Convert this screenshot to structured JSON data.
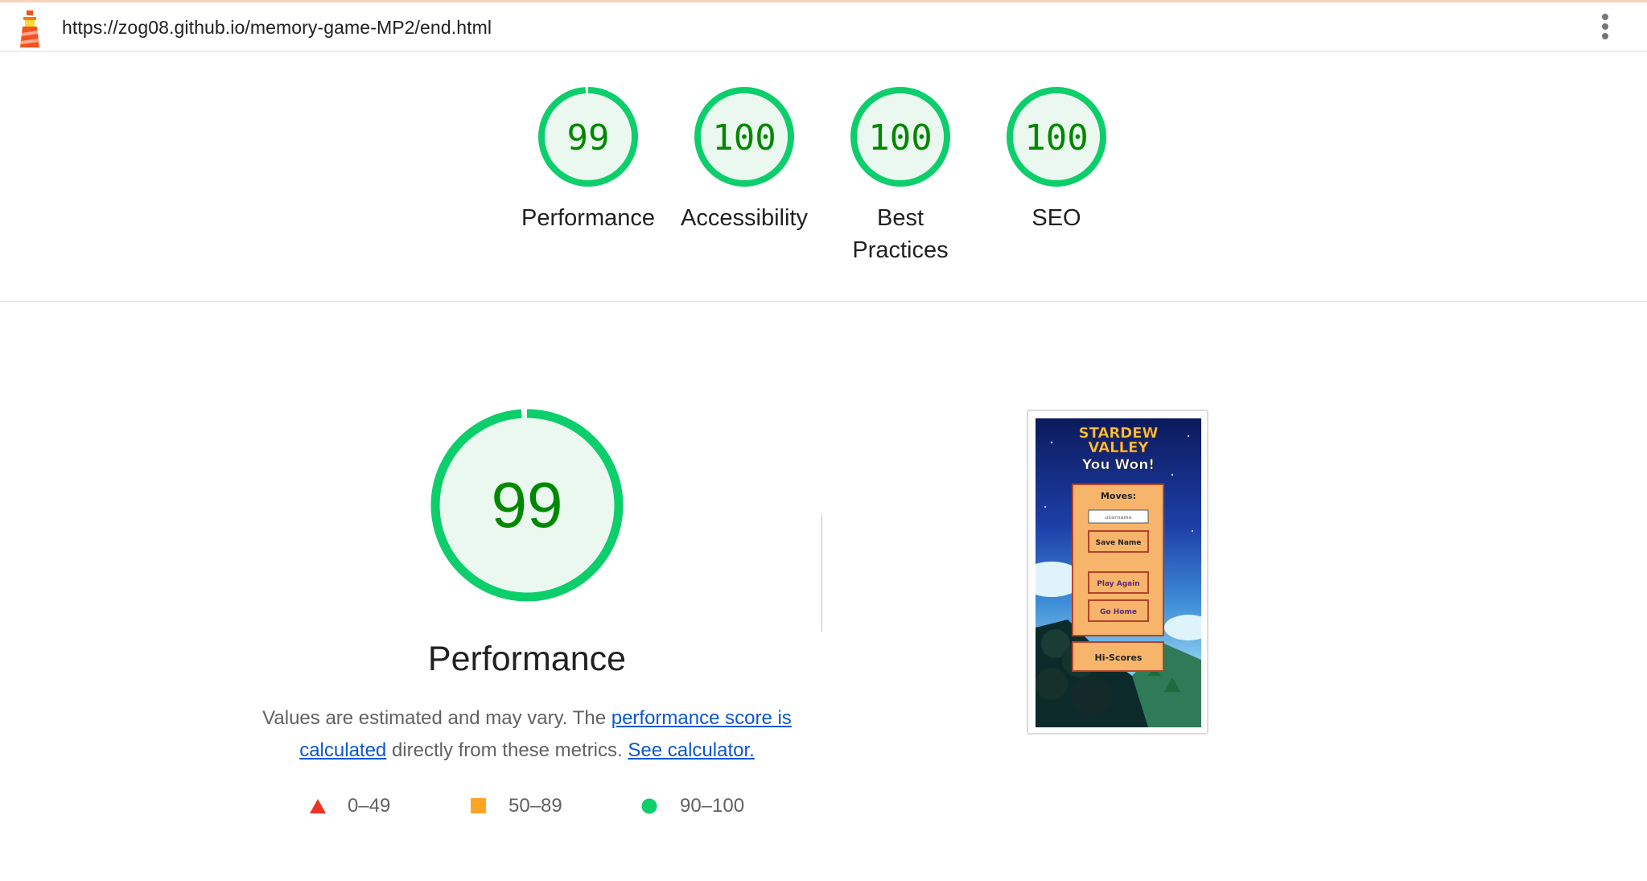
{
  "browser": {
    "url": "https://zog08.github.io/memory-game-MP2/end.html",
    "logo_icon": "lighthouse-icon",
    "menu_icon": "kebab-menu-icon"
  },
  "categories": [
    {
      "score": "99",
      "label": "Performance",
      "fraction": 0.99
    },
    {
      "score": "100",
      "label": "Accessibility",
      "fraction": 1.0
    },
    {
      "score": "100",
      "label": "Best Practices",
      "fraction": 1.0
    },
    {
      "score": "100",
      "label": "SEO",
      "fraction": 1.0
    }
  ],
  "performance": {
    "score": "99",
    "fraction": 0.99,
    "title": "Performance",
    "desc_before": "Values are estimated and may vary. The ",
    "link_score": "performance score is calculated",
    "desc_middle": " directly from these metrics. ",
    "link_calculator": "See calculator."
  },
  "legend": [
    {
      "shape": "triangle",
      "label": "0–49",
      "color": "#eb3223"
    },
    {
      "shape": "square",
      "label": "50–89",
      "color": "#ffa526"
    },
    {
      "shape": "circle",
      "label": "90–100",
      "color": "#0cce6b"
    }
  ],
  "colors": {
    "pass": "#0cce6b",
    "pass_text": "#008800",
    "pass_fill": "#ebf8f0",
    "link": "#0b57d0"
  },
  "thumbnail": {
    "game_title_line1": "STARDEW",
    "game_title_line2": "VALLEY",
    "heading": "You Won!",
    "moves_label": "Moves:",
    "input_placeholder": "username",
    "save_button": "Save Name",
    "play_again_button": "Play Again",
    "go_home_button": "Go Home",
    "hiscores_button": "Hi-Scores"
  }
}
